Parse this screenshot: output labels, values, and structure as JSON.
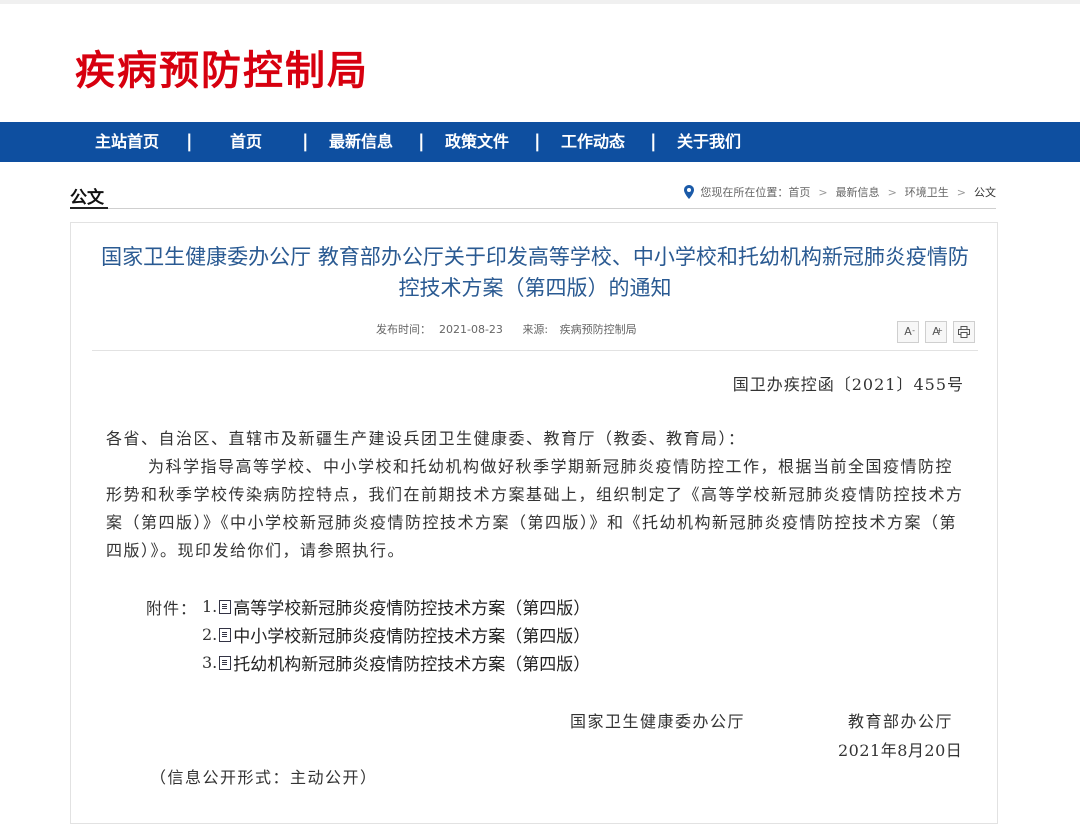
{
  "site": {
    "logo": "疾病预防控制局"
  },
  "nav": {
    "items": [
      {
        "label": "主站首页"
      },
      {
        "label": "首页"
      },
      {
        "label": "最新信息"
      },
      {
        "label": "政策文件"
      },
      {
        "label": "工作动态"
      },
      {
        "label": "关于我们"
      }
    ],
    "separator": "|"
  },
  "section": {
    "title": "公文"
  },
  "breadcrumb": {
    "prefix": "您现在所在位置：",
    "items": [
      "首页",
      "最新信息",
      "环境卫生",
      "公文"
    ],
    "separator": ">"
  },
  "article": {
    "title": "国家卫生健康委办公厅 教育部办公厅关于印发高等学校、中小学校和托幼机构新冠肺炎疫情防控技术方案（第四版）的通知",
    "publish_label": "发布时间：",
    "publish_date": "2021-08-23",
    "source_label": "来源: ",
    "source": "疾病预防控制局",
    "tools": {
      "font_decrease": "A",
      "font_increase": "A",
      "print_icon": "printer-icon"
    },
    "doc_number": "国卫办疾控函〔2021〕455号",
    "addressee": "各省、自治区、直辖市及新疆生产建设兵团卫生健康委、教育厅（教委、教育局）：",
    "body": "为科学指导高等学校、中小学校和托幼机构做好秋季学期新冠肺炎疫情防控工作，根据当前全国疫情防控形势和秋季学校传染病防控特点，我们在前期技术方案基础上，组织制定了《高等学校新冠肺炎疫情防控技术方案（第四版）》《中小学校新冠肺炎疫情防控技术方案（第四版）》和《托幼机构新冠肺炎疫情防控技术方案（第四版）》。现印发给你们，请参照执行。",
    "attachments_label": "附件：",
    "attachments": [
      {
        "num": "1.",
        "title": "高等学校新冠肺炎疫情防控技术方案（第四版）"
      },
      {
        "num": "2.",
        "title": "中小学校新冠肺炎疫情防控技术方案（第四版）"
      },
      {
        "num": "3.",
        "title": "托幼机构新冠肺炎疫情防控技术方案（第四版）"
      }
    ],
    "signatories": [
      "国家卫生健康委办公厅",
      "教育部办公厅"
    ],
    "sign_date": "2021年8月20日",
    "disclosure": "（信息公开形式：主动公开）"
  },
  "colors": {
    "brand_red": "#d7000f",
    "nav_blue": "#0e4fa0",
    "title_blue": "#2a5a92"
  }
}
